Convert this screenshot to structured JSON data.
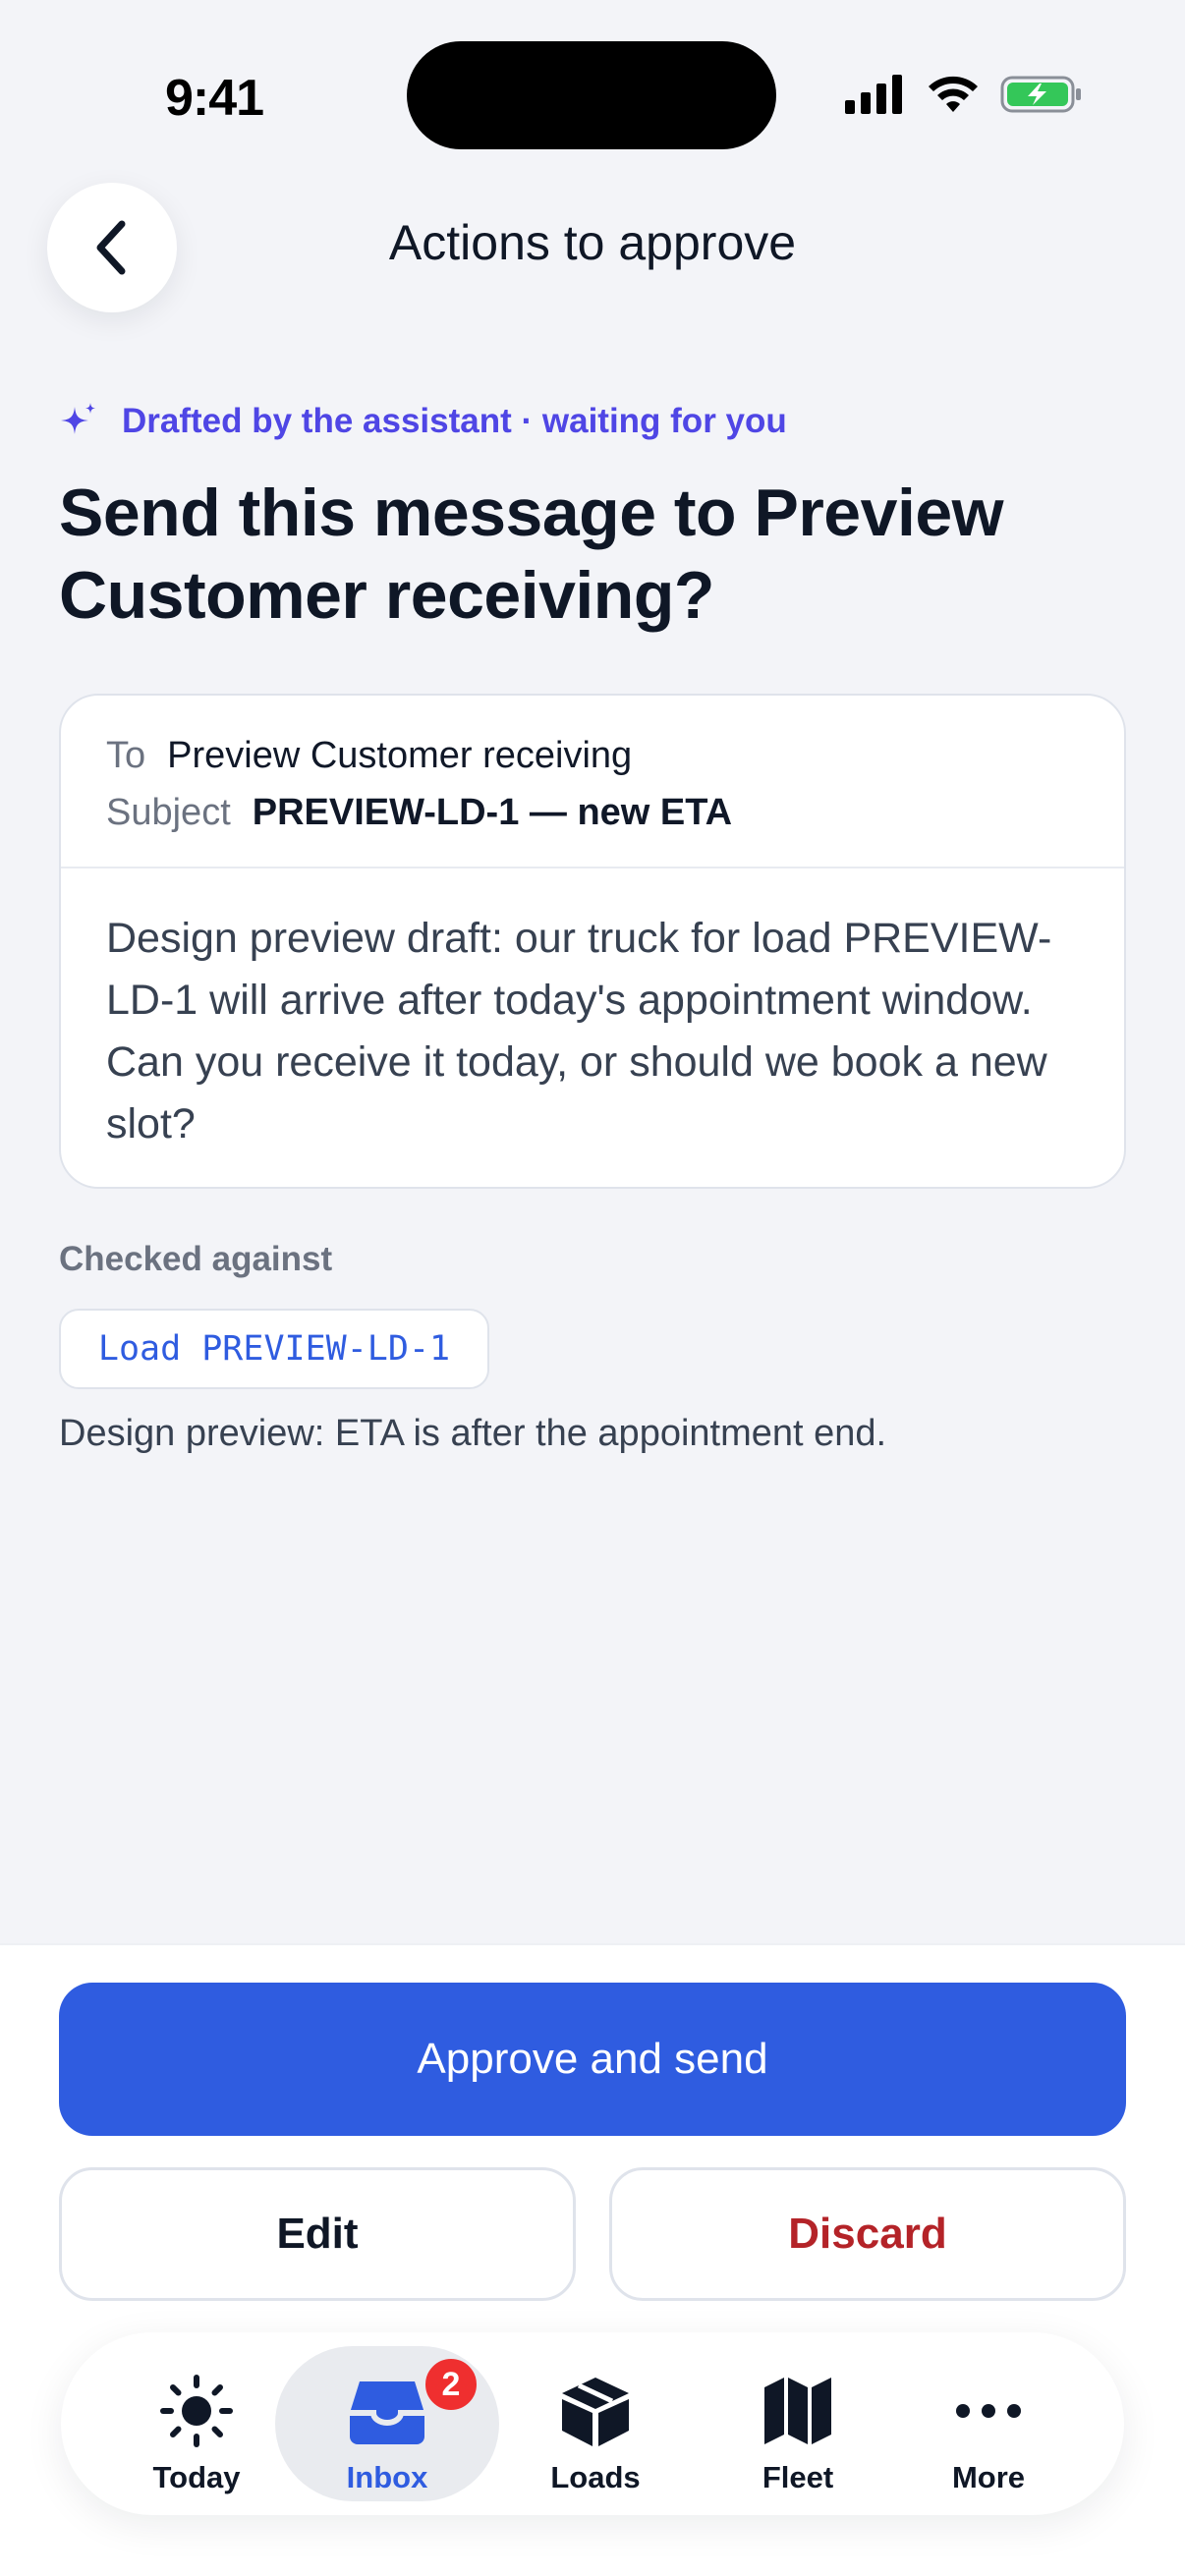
{
  "status_bar": {
    "time": "9:41"
  },
  "header": {
    "title": "Actions to approve"
  },
  "draft": {
    "tag": "Drafted by the assistant · waiting for you",
    "headline": "Send this message to Preview Customer receiving?"
  },
  "message": {
    "to_label": "To",
    "to_value": "Preview Customer receiving",
    "subject_label": "Subject",
    "subject_value": "PREVIEW-LD-1 — new ETA",
    "body": "Design preview draft: our truck for load PREVIEW-LD-1 will arrive after today's appointment window. Can you receive it today, or should we book a new slot?"
  },
  "checked": {
    "label": "Checked against",
    "chip": "Load PREVIEW-LD-1",
    "note": "Design preview: ETA is after the appointment end."
  },
  "actions": {
    "approve": "Approve and send",
    "edit": "Edit",
    "discard": "Discard"
  },
  "tabs": [
    {
      "label": "Today",
      "icon": "sun-icon"
    },
    {
      "label": "Inbox",
      "icon": "inbox-icon",
      "badge": "2",
      "active": true
    },
    {
      "label": "Loads",
      "icon": "box-icon"
    },
    {
      "label": "Fleet",
      "icon": "map-icon"
    },
    {
      "label": "More",
      "icon": "more-icon"
    }
  ],
  "colors": {
    "accent": "#2f5ce0",
    "assistant": "#4f46e5",
    "danger": "#b42328",
    "badge": "#ef2f2f",
    "background": "#f3f4f8"
  }
}
